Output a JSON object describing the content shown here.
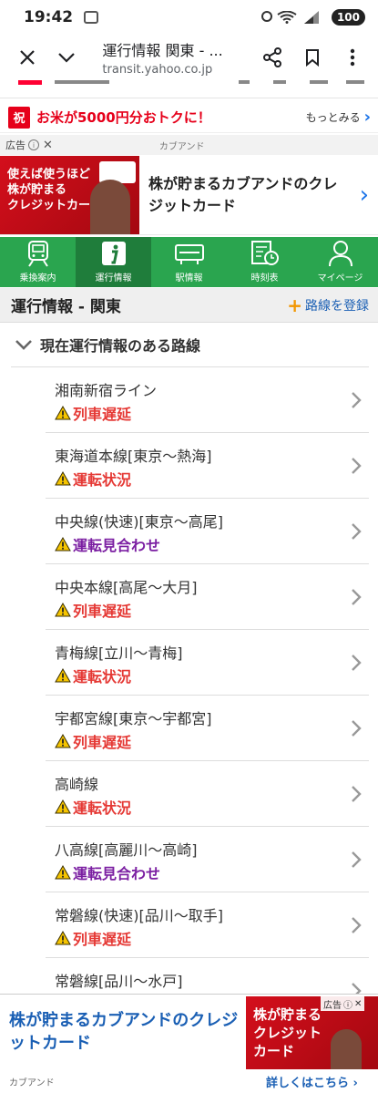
{
  "status_bar": {
    "time": "19:42",
    "battery": "100"
  },
  "browser": {
    "title": "運行情報 関東 - ...",
    "url": "transit.yahoo.co.jp"
  },
  "promo": {
    "badge": "祝",
    "text": "お米が5000円分おトクに！",
    "more": "もっとみる"
  },
  "top_ad": {
    "label": "広告",
    "sponsor": "カブアンド",
    "image_text": "使えば使うほど\n株が貯まる\nクレジットカード",
    "headline": "株が貯まるカブアンドのクレジットカード"
  },
  "nav": {
    "items": [
      {
        "label": "乗換案内",
        "icon": "train-icon"
      },
      {
        "label": "運行情報",
        "icon": "info-icon",
        "active": true
      },
      {
        "label": "駅情報",
        "icon": "station-icon"
      },
      {
        "label": "時刻表",
        "icon": "timetable-icon"
      },
      {
        "label": "マイページ",
        "icon": "user-icon"
      }
    ]
  },
  "page": {
    "title": "運行情報 - 関東",
    "add_route": "路線を登録",
    "section_title": "現在運行情報のある路線"
  },
  "routes": [
    {
      "name": "湘南新宿ライン",
      "status": "列車遅延",
      "status_color": "#e53935"
    },
    {
      "name": "東海道本線[東京～熱海]",
      "status": "運転状況",
      "status_color": "#e53935"
    },
    {
      "name": "中央線(快速)[東京～高尾]",
      "status": "運転見合わせ",
      "status_color": "#7b1fa2"
    },
    {
      "name": "中央本線[高尾～大月]",
      "status": "列車遅延",
      "status_color": "#e53935"
    },
    {
      "name": "青梅線[立川～青梅]",
      "status": "運転状況",
      "status_color": "#e53935"
    },
    {
      "name": "宇都宮線[東京～宇都宮]",
      "status": "列車遅延",
      "status_color": "#e53935"
    },
    {
      "name": "高崎線",
      "status": "運転状況",
      "status_color": "#e53935"
    },
    {
      "name": "八高線[高麗川～高崎]",
      "status": "運転見合わせ",
      "status_color": "#7b1fa2"
    },
    {
      "name": "常磐線(快速)[品川～取手]",
      "status": "列車遅延",
      "status_color": "#e53935"
    },
    {
      "name": "常磐線[品川～水戸]",
      "status": "",
      "status_color": "#e53935"
    }
  ],
  "bottom_ad": {
    "headline": "株が貯まるカブアンドのクレジットカード",
    "label": "広告",
    "image_text": "株が貯まる\nクレジット\nカード",
    "sponsor": "カブアンド",
    "more": "詳しくはこちら"
  },
  "colors": {
    "brand_green": "#2aa54f",
    "nav_active": "#1f7d3b",
    "link_blue": "#1a5fb4",
    "warn_red": "#e53935",
    "warn_purple": "#7b1fa2"
  }
}
